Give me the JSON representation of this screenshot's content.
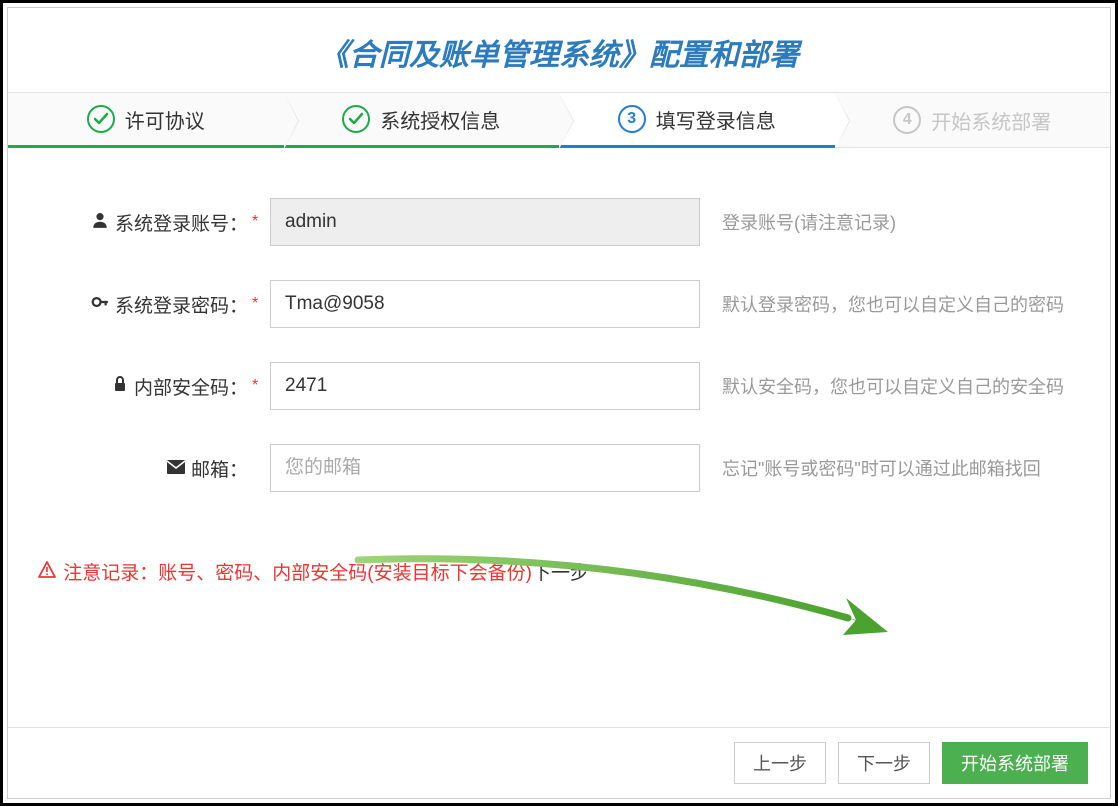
{
  "header": {
    "title": "《合同及账单管理系统》配置和部署"
  },
  "steps": [
    {
      "num": "✓",
      "label": "许可协议",
      "state": "done"
    },
    {
      "num": "✓",
      "label": "系统授权信息",
      "state": "done"
    },
    {
      "num": "3",
      "label": "填写登录信息",
      "state": "active"
    },
    {
      "num": "4",
      "label": "开始系统部署",
      "state": "pending"
    }
  ],
  "form": {
    "account": {
      "label": "系统登录账号：",
      "value": "admin",
      "hint": "登录账号(请注意记录)",
      "required": "*"
    },
    "password": {
      "label": "系统登录密码：",
      "value": "Tma@9058",
      "hint": "默认登录密码，您也可以自定义自己的密码",
      "required": "*"
    },
    "seccode": {
      "label": "内部安全码：",
      "value": "2471",
      "hint": "默认安全码，您也可以自定义自己的安全码",
      "required": "*"
    },
    "email": {
      "label": "邮箱：",
      "value": "",
      "placeholder": "您的邮箱",
      "hint": "忘记\"账号或密码\"时可以通过此邮箱找回"
    }
  },
  "warning": {
    "text": "注意记录：账号、密码、内部安全码(安装目标下会备份)",
    "next": "下一步"
  },
  "footer": {
    "prev": "上一步",
    "next": "下一步",
    "deploy": "开始系统部署"
  }
}
